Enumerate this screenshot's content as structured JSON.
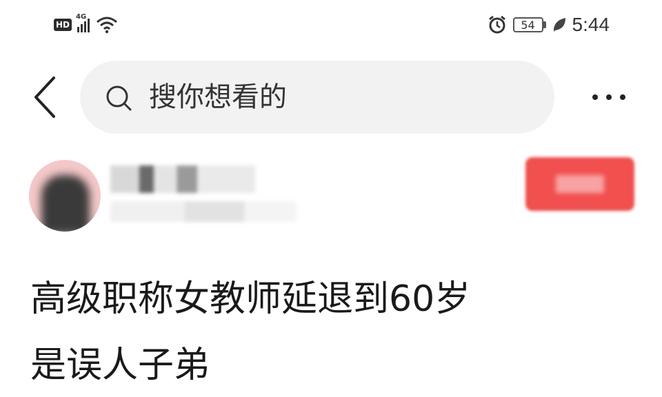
{
  "status_bar": {
    "hd": "HD",
    "network": "4G",
    "battery": "54",
    "time": "5:44"
  },
  "search": {
    "placeholder": "搜你想看的"
  },
  "post": {
    "title_line1": "高级职称女教师延退到60岁",
    "title_line2": "是误人子弟"
  },
  "colors": {
    "follow_button": "#f24f4f",
    "search_background": "#f2f2f2"
  }
}
